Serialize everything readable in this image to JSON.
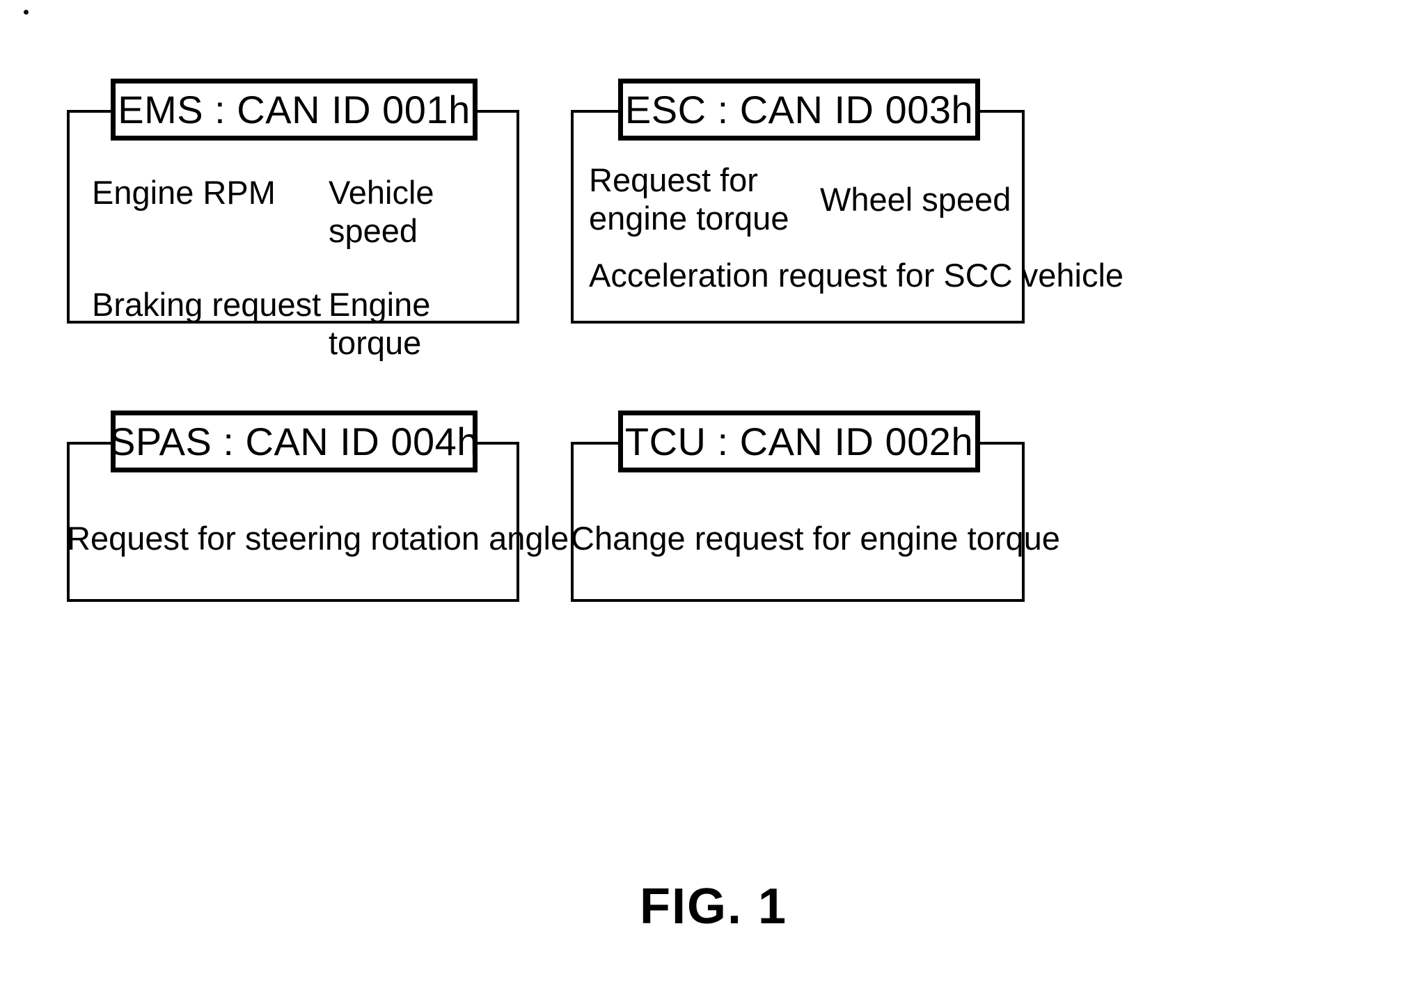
{
  "figure": {
    "caption": "FIG. 1"
  },
  "blocks": [
    {
      "id": "ems",
      "header": "EMS : CAN ID 001h",
      "signals": [
        "Engine RPM",
        "Vehicle speed",
        "Braking request",
        "Engine torque"
      ]
    },
    {
      "id": "esc",
      "header": "ESC : CAN ID 003h",
      "signals": [
        "Request for\nengine torque",
        "Wheel speed"
      ],
      "full_width_signal": "Acceleration request for SCC vehicle"
    },
    {
      "id": "spas",
      "header": "SPAS : CAN ID 004h",
      "full_width_signal": "Request for steering rotation angle"
    },
    {
      "id": "tcu",
      "header": "TCU : CAN ID 002h",
      "full_width_signal": "Change request for engine torque"
    }
  ]
}
